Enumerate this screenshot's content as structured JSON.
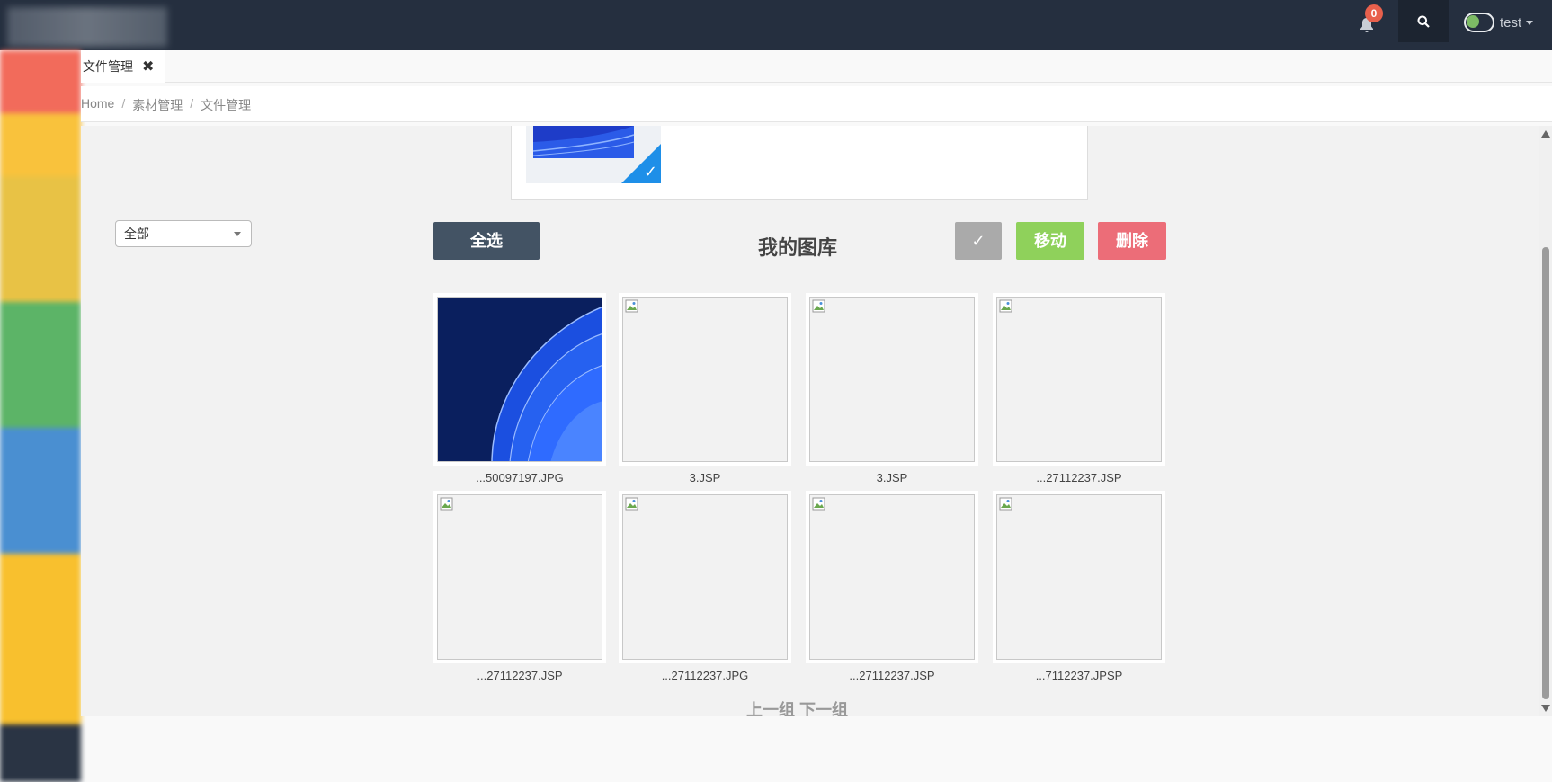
{
  "header": {
    "notification_count": "0",
    "user_name": "test"
  },
  "tabs": [
    {
      "label": "文件管理",
      "close": "✖"
    }
  ],
  "breadcrumb": [
    "Home",
    "素材管理",
    "文件管理"
  ],
  "filter": {
    "selected": "全部"
  },
  "toolbar": {
    "select_all": "全选",
    "confirm": "✓",
    "move": "移动",
    "delete": "删除"
  },
  "gallery": {
    "title": "我的图库",
    "items": [
      {
        "name": "...50097197.JPG",
        "has_image": true
      },
      {
        "name": "3.JSP",
        "has_image": false
      },
      {
        "name": "3.JSP",
        "has_image": false
      },
      {
        "name": "...27112237.JSP",
        "has_image": false
      },
      {
        "name": "...27112237.JSP",
        "has_image": false
      },
      {
        "name": "...27112237.JPG",
        "has_image": false
      },
      {
        "name": "...27112237.JSP",
        "has_image": false
      },
      {
        "name": "...7112237.JPSP",
        "has_image": false
      }
    ]
  },
  "pager": {
    "prev": "上一组",
    "next": "下一组"
  },
  "colors": {
    "topbar": "#252f3f",
    "select_all_button": "#435364",
    "confirm_button": "#aaaaaa",
    "move_button": "#8fd15b",
    "delete_button": "#ec6d78",
    "notification_badge": "#e8604c",
    "selected_check": "#1e8fe8",
    "sidebar_bands": [
      "#f26b5b",
      "#f9c23c",
      "#e8c245",
      "#5cb467",
      "#4a8fd1",
      "#f8c02e",
      "#2a3444"
    ]
  }
}
